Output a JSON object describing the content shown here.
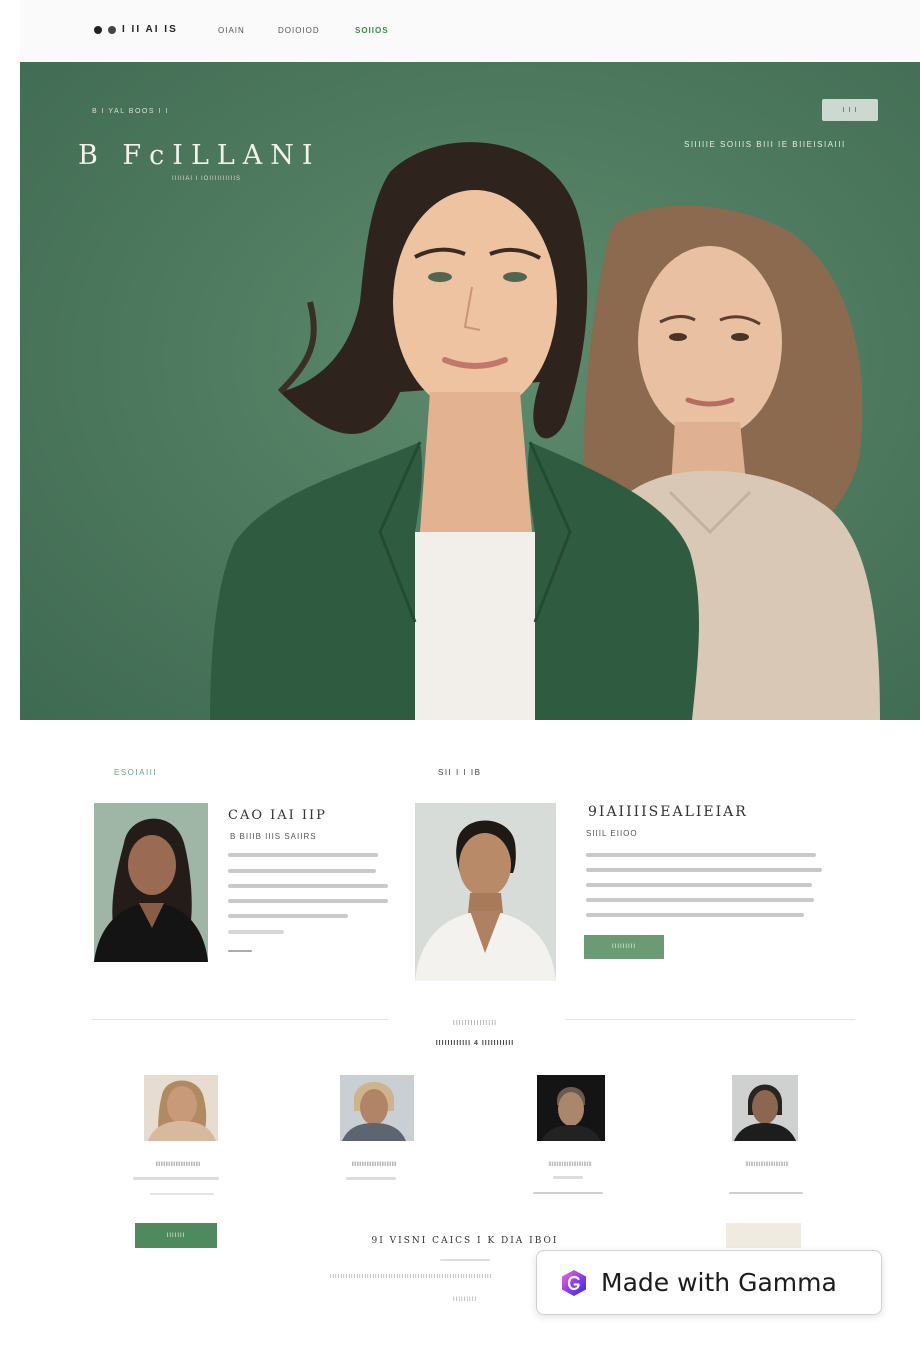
{
  "nav": {
    "logo": "I II AI IS",
    "links": [
      "OIAIN",
      "DOIOIOD",
      "SOIIOS"
    ]
  },
  "hero": {
    "kicker": "B I YAL  BOOS I I",
    "title": "B  FcILLANI",
    "subtitle": "IIIIIAI I IOIIIIIIIIIIS",
    "button": "I  I I",
    "tagline": "SIIIIIE  SOIIIS BIII  IE BIIEISIAIII"
  },
  "section": {
    "left_label": "ESOIAIII",
    "center_label": "SII  I  I IB"
  },
  "profiles": [
    {
      "name": "CAO IAI IIP",
      "role": "B BIIIB IIIS SAIIRS"
    },
    {
      "name": "9IAIIIISEALIEIAR",
      "role": "SIIIL EIIOO",
      "button": "IIIIIIIII"
    }
  ],
  "team": {
    "heading": "IIIIIIIIIIIIIII",
    "sub": "IIIIIIIIIIII   4   IIIIIIIIIII",
    "captions": [
      "IIIIIIIIIIIIIIIIIIIIIIIIIII",
      "IIIIIIIIIIIIIIIIIIIIIIIIIII",
      "IIIIIIIIIIIIIIIIIIIIIIIIII",
      "IIIIIIIIIIIIIIIIIIIIIIIIII"
    ]
  },
  "footer": {
    "button": "IIIIIII",
    "title": "9I VISNI   CAICS I  K DIA IBOI",
    "text": "IIIIIIIIIIIIIIIIIIIIIIIIIIIIIIIIIIIIIIIIIIIIIIIIIIIIIIIIIIIII",
    "small": "IIIIIIIII"
  },
  "badge": {
    "text": "Made with Gamma"
  },
  "colors": {
    "hero_green": "#4f7b60",
    "accent_green": "#6a9b74",
    "nav_active": "#3d8a4e",
    "gamma_logo": "#7b3fe4"
  }
}
